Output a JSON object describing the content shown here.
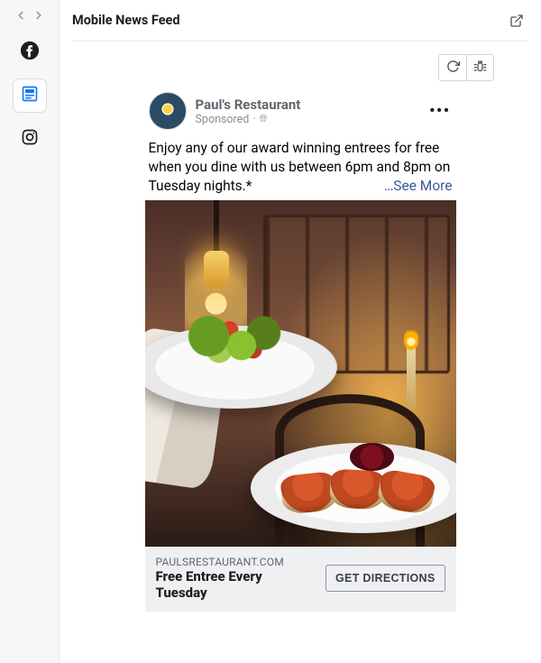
{
  "header": {
    "title": "Mobile News Feed"
  },
  "sidebar": {
    "items": [
      {
        "name": "facebook"
      },
      {
        "name": "feed-preview"
      },
      {
        "name": "instagram"
      }
    ]
  },
  "post": {
    "page_name": "Paul's Restaurant",
    "sponsored_label": "Sponsored",
    "body_text": "Enjoy any of our award winning entrees for free when you dine with us between 6pm and 8pm on Tuesday nights.*",
    "see_more_label": "…See More",
    "image_alt": "Server carrying two plates: a salad and bruschetta, in a warmly lit restaurant",
    "cta": {
      "domain": "PAULSRESTAURANT.COM",
      "headline": "Free Entree Every Tuesday",
      "button_label": "GET DIRECTIONS"
    }
  }
}
